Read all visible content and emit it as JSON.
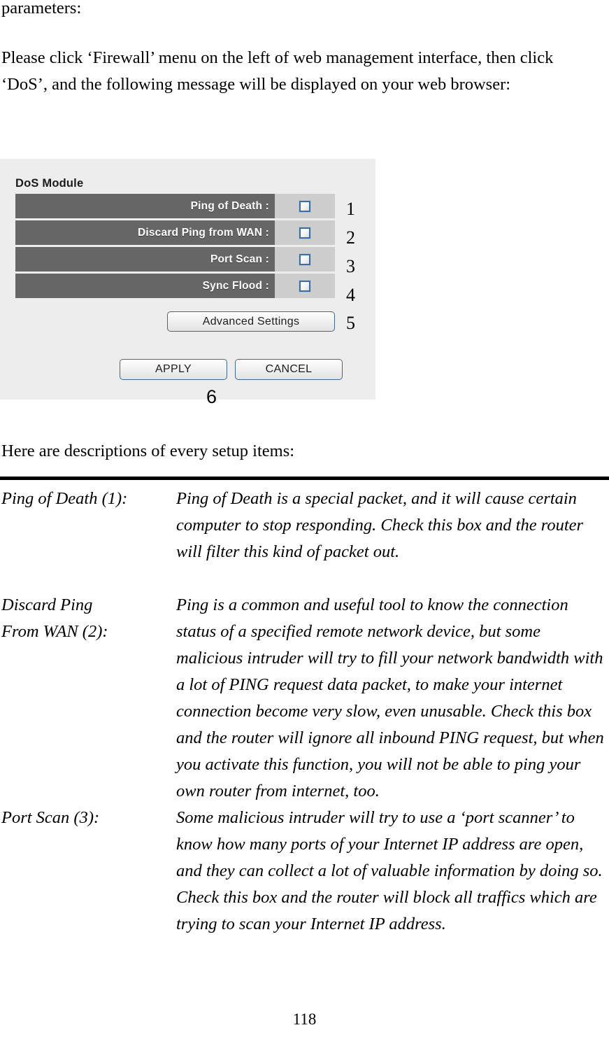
{
  "document": {
    "para_parameters": "parameters:",
    "para_intro": "Please click ‘Firewall’ menu on the left of web management interface, then click ‘DoS’, and the following message will be displayed on your web browser:",
    "para_here_descriptions": "Here are descriptions of every setup items:",
    "page_number": "118"
  },
  "dos_panel": {
    "title": "DoS Module",
    "rows": [
      {
        "label": "Ping of Death :",
        "checked": false,
        "callout": "1"
      },
      {
        "label": "Discard Ping from WAN :",
        "checked": false,
        "callout": "2"
      },
      {
        "label": "Port Scan :",
        "checked": false,
        "callout": "3"
      },
      {
        "label": "Sync Flood :",
        "checked": false,
        "callout": "4"
      }
    ],
    "advanced_settings_label": "Advanced Settings",
    "advanced_settings_callout": "5",
    "apply_label": "APPLY",
    "cancel_label": "CANCEL",
    "form_callout": "6",
    "colors": {
      "panel_background": "#ededed",
      "row_label_background": "#666666",
      "row_value_background": "#cdcdcd",
      "row_label_text": "#ffffff",
      "checkbox_border": "#3b6ea5",
      "button_border": "#41688f"
    }
  },
  "descriptions": [
    {
      "term": "Ping of Death (1):",
      "body": "Ping of Death is a special packet, and it will cause certain computer to stop responding. Check this box and the router will filter this kind of packet out."
    },
    {
      "term": "Discard Ping\nFrom WAN (2):",
      "body": "Ping is a common and useful tool to know the connection status of a specified remote network device, but some malicious intruder will try to fill your network bandwidth with a lot of PING request data packet, to make your internet connection become very slow, even unusable. Check this box and the router will ignore all inbound PING request, but when you activate this function, you will not be able to ping your own router from internet, too."
    },
    {
      "term": "Port Scan (3):",
      "body": "Some malicious intruder will try to use a ‘port scanner’ to know how many ports of your Internet IP address are open, and they can collect a lot of valuable information by doing so. Check this box and the router will block all traffics which are trying to scan your Internet IP address."
    }
  ]
}
